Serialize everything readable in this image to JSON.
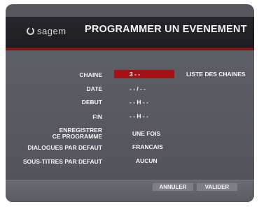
{
  "header": {
    "brand": "sagem",
    "title": "PROGRAMMER UN EVENEMENT"
  },
  "form": {
    "chaine_label": "CHAINE",
    "chaine_value": "3 - -",
    "channel_list": "LISTE DES CHAINES",
    "date_label": "DATE",
    "date_value": "- - / - -",
    "debut_label": "DEBUT",
    "debut_value": "- - H - -",
    "fin_label": "FIN",
    "fin_value": "- - H - -",
    "record_label_line1": "ENREGISTRER",
    "record_label_line2": "CE PROGRAMME",
    "record_value": "UNE FOIS",
    "dialogues_label": "DIALOGUES PAR DEFAUT",
    "dialogues_value": "FRANCAIS",
    "subtitles_label": "SOUS-TITRES PAR DEFAUT",
    "subtitles_value": "AUCUN"
  },
  "footer": {
    "cancel_label": "ANNULER",
    "validate_label": "VALIDER"
  },
  "colors": {
    "accent": "#a41216",
    "panel": "#55565e",
    "header": "#222227"
  }
}
